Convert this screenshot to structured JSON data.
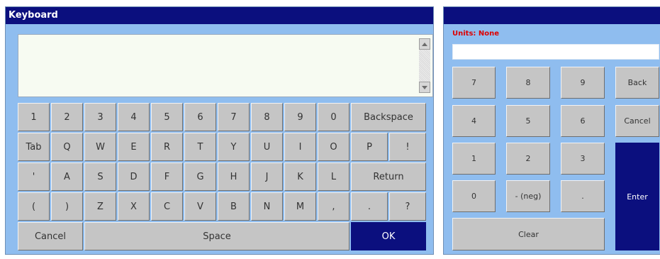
{
  "keyboard": {
    "title": "Keyboard",
    "rows": [
      [
        {
          "label": "1"
        },
        {
          "label": "2"
        },
        {
          "label": "3"
        },
        {
          "label": "4"
        },
        {
          "label": "5"
        },
        {
          "label": "6"
        },
        {
          "label": "7"
        },
        {
          "label": "8"
        },
        {
          "label": "9"
        },
        {
          "label": "0"
        },
        {
          "label": "Backspace"
        }
      ],
      [
        {
          "label": "Tab"
        },
        {
          "label": "Q"
        },
        {
          "label": "W"
        },
        {
          "label": "E"
        },
        {
          "label": "R"
        },
        {
          "label": "T"
        },
        {
          "label": "Y"
        },
        {
          "label": "U"
        },
        {
          "label": "I"
        },
        {
          "label": "O"
        },
        {
          "label": "P"
        },
        {
          "label": "!"
        }
      ],
      [
        {
          "label": "'"
        },
        {
          "label": "A"
        },
        {
          "label": "S"
        },
        {
          "label": "D"
        },
        {
          "label": "F"
        },
        {
          "label": "G"
        },
        {
          "label": "H"
        },
        {
          "label": "J"
        },
        {
          "label": "K"
        },
        {
          "label": "L"
        },
        {
          "label": "Return"
        }
      ],
      [
        {
          "label": "("
        },
        {
          "label": ")"
        },
        {
          "label": "Z"
        },
        {
          "label": "X"
        },
        {
          "label": "C"
        },
        {
          "label": "V"
        },
        {
          "label": "B"
        },
        {
          "label": "N"
        },
        {
          "label": "M"
        },
        {
          "label": ","
        },
        {
          "label": "."
        },
        {
          "label": "?"
        }
      ]
    ],
    "cancel": "Cancel",
    "space": "Space",
    "ok": "OK"
  },
  "numpad": {
    "units": "Units: None",
    "keys": {
      "k7": "7",
      "k8": "8",
      "k9": "9",
      "back": "Back",
      "k4": "4",
      "k5": "5",
      "k6": "6",
      "cancel": "Cancel",
      "k1": "1",
      "k2": "2",
      "k3": "3",
      "k0": "0",
      "neg": "- (neg)",
      "dot": ".",
      "enter": "Enter",
      "clear": "Clear"
    }
  },
  "colors": {
    "titlebar": "#0b0f7e",
    "panel": "#8fbdef",
    "key": "#c5c5c5",
    "units": "#dd0000"
  }
}
